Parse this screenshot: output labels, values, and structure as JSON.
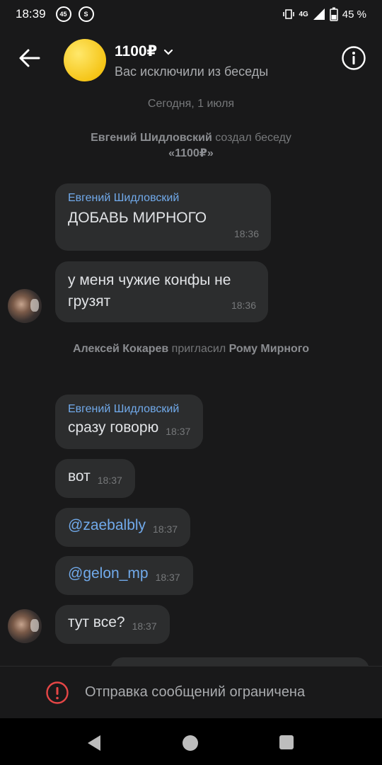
{
  "status_bar": {
    "time": "18:39",
    "notif_badge": "45",
    "network": "4G",
    "battery": "45 %"
  },
  "header": {
    "title": "1100₽",
    "subtitle": "Вас исключили из беседы"
  },
  "feed": {
    "date_separator": "Сегодня, 1 июля",
    "service_1": {
      "actor": "Евгений Шидловский",
      "action": " создал беседу",
      "target": "«1100₽»"
    },
    "messages": [
      {
        "author": "Евгений Шидловский",
        "text": "ДОБАВЬ МИРНОГО",
        "time": "18:36"
      },
      {
        "author": "",
        "text": "у меня чужие конфы не грузят",
        "time": "18:36"
      },
      {
        "author": "Евгений Шидловский",
        "text": "сразу говорю",
        "time": "18:37"
      },
      {
        "author": "",
        "text": "вот",
        "time": "18:37"
      },
      {
        "author": "",
        "text": "@zaebalbly",
        "time": "18:37"
      },
      {
        "author": "",
        "text": "@gelon_mp",
        "time": "18:37"
      },
      {
        "author": "",
        "text": "тут все?",
        "time": "18:37"
      }
    ],
    "service_2": {
      "actor": "Алексей Кокарев",
      "action": " пригласил ",
      "target": "Рому Мирного"
    }
  },
  "footer": {
    "restricted_text": "Отправка сообщений ограничена"
  },
  "colors": {
    "background": "#19191a",
    "bubble": "#2c2d2e",
    "link": "#71aaeb",
    "error": "#e64646",
    "avatar_yellow": "#f5c518"
  }
}
